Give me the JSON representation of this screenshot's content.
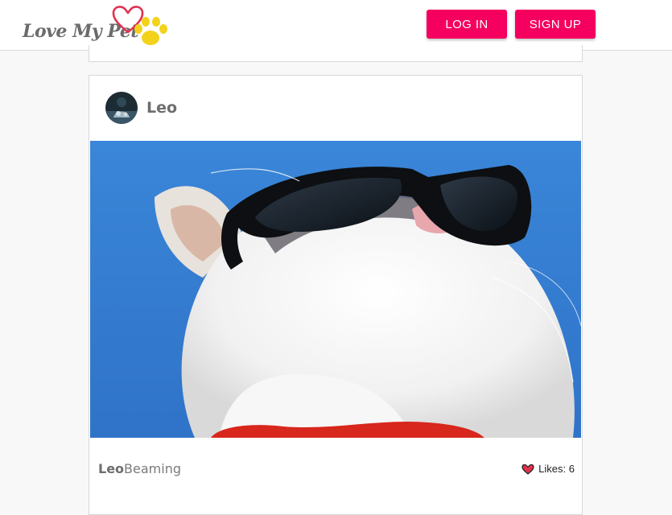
{
  "header": {
    "logo_text": "Love My Pet",
    "login_label": "LOG IN",
    "signup_label": "SIGN UP"
  },
  "post": {
    "author": "Leo",
    "caption_user": "Leo",
    "caption_text": "Beaming",
    "likes_label": "Likes:",
    "likes_count": "6"
  },
  "colors": {
    "accent": "#f5005f",
    "header_bg": "#ffffff",
    "page_bg": "#f8f8f8",
    "heart": "#e0334d",
    "paw": "#f2d21b"
  },
  "icons": {
    "logo_heart": "heart-outline-icon",
    "logo_paw": "paw-icon",
    "like": "heart-icon"
  }
}
